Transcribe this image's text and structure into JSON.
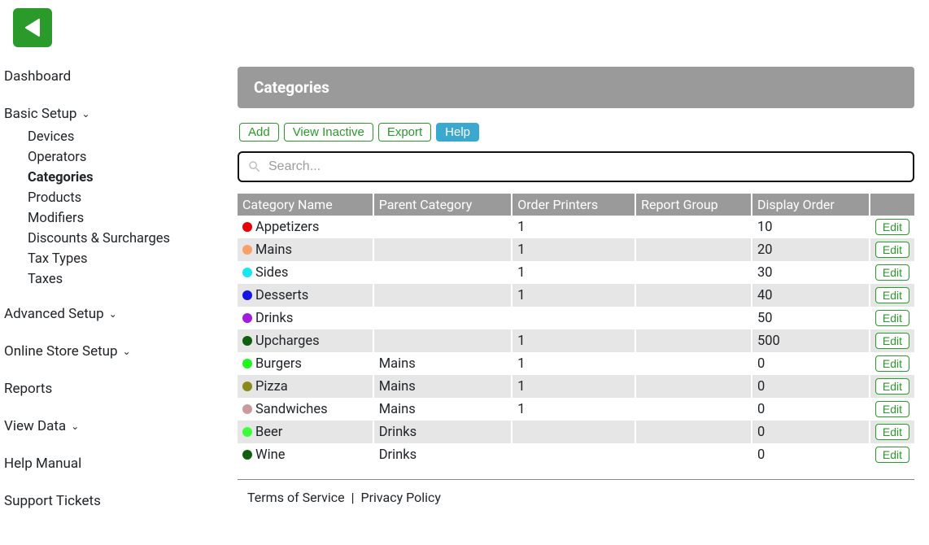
{
  "sidebar": {
    "items": [
      {
        "label": "Dashboard",
        "expandable": false
      },
      {
        "label": "Basic Setup",
        "expandable": true,
        "children": [
          {
            "label": "Devices"
          },
          {
            "label": "Operators"
          },
          {
            "label": "Categories",
            "active": true
          },
          {
            "label": "Products"
          },
          {
            "label": "Modifiers"
          },
          {
            "label": "Discounts & Surcharges"
          },
          {
            "label": "Tax Types"
          },
          {
            "label": "Taxes"
          }
        ]
      },
      {
        "label": "Advanced Setup",
        "expandable": true
      },
      {
        "label": "Online Store Setup",
        "expandable": true
      },
      {
        "label": "Reports",
        "expandable": false
      },
      {
        "label": "View Data",
        "expandable": true
      },
      {
        "label": "Help Manual",
        "expandable": false
      },
      {
        "label": "Support Tickets",
        "expandable": false
      }
    ]
  },
  "panel": {
    "title": "Categories"
  },
  "toolbar": {
    "add": "Add",
    "view_inactive": "View Inactive",
    "export": "Export",
    "help": "Help"
  },
  "search": {
    "placeholder": "Search..."
  },
  "table": {
    "headers": [
      "Category Name",
      "Parent Category",
      "Order Printers",
      "Report Group",
      "Display Order",
      ""
    ],
    "edit_label": "Edit",
    "rows": [
      {
        "color": "#e60000",
        "name": "Appetizers",
        "parent": "",
        "printers": "1",
        "group": "",
        "order": "10"
      },
      {
        "color": "#f7a06a",
        "name": "Mains",
        "parent": "",
        "printers": "1",
        "group": "",
        "order": "20"
      },
      {
        "color": "#17e8f0",
        "name": "Sides",
        "parent": "",
        "printers": "1",
        "group": "",
        "order": "30"
      },
      {
        "color": "#1414e6",
        "name": "Desserts",
        "parent": "",
        "printers": "1",
        "group": "",
        "order": "40"
      },
      {
        "color": "#a31ae0",
        "name": "Drinks",
        "parent": "",
        "printers": "",
        "group": "",
        "order": "50"
      },
      {
        "color": "#0f5f0f",
        "name": "Upcharges",
        "parent": "",
        "printers": "1",
        "group": "",
        "order": "500"
      },
      {
        "color": "#1df71d",
        "name": "Burgers",
        "parent": "Mains",
        "printers": "1",
        "group": "",
        "order": "0"
      },
      {
        "color": "#8a8a1a",
        "name": "Pizza",
        "parent": "Mains",
        "printers": "1",
        "group": "",
        "order": "0"
      },
      {
        "color": "#c99b9b",
        "name": "Sandwiches",
        "parent": "Mains",
        "printers": "1",
        "group": "",
        "order": "0"
      },
      {
        "color": "#3bff3b",
        "name": "Beer",
        "parent": "Drinks",
        "printers": "",
        "group": "",
        "order": "0"
      },
      {
        "color": "#0f5f0f",
        "name": "Wine",
        "parent": "Drinks",
        "printers": "",
        "group": "",
        "order": "0"
      }
    ]
  },
  "footer": {
    "tos": "Terms of Service",
    "sep": "|",
    "privacy": "Privacy Policy"
  }
}
